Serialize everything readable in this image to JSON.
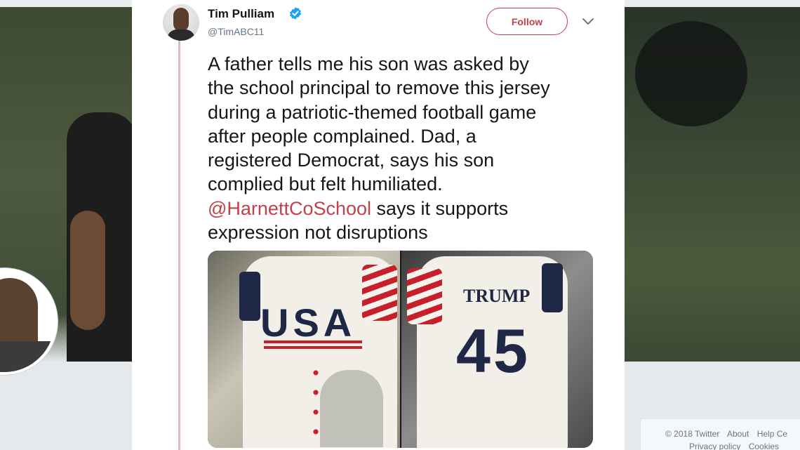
{
  "tweet": {
    "author_name": "Tim Pulliam",
    "author_handle": "@TimABC11",
    "follow_label": "Follow",
    "text_lines": [
      "A father tells me his son was asked by",
      "the school principal to remove this jersey",
      "during a patriotic-themed football game",
      "after people complained. Dad, a",
      "registered Democrat, says his son",
      "complied but felt humiliated."
    ],
    "mention": "@HarnettCoSchool",
    "text_after_mention": " says it supports",
    "last_line": "expression not disruptions",
    "media": {
      "left_jersey_text": "USA",
      "right_jersey_name": "TRUMP",
      "right_jersey_number": "45"
    }
  },
  "footer": {
    "copyright": "© 2018 Twitter",
    "about": "About",
    "help": "Help Ce",
    "privacy": "Privacy policy",
    "cookies": "Cookies"
  },
  "colors": {
    "accent": "#c0424a",
    "verified": "#1da1f2",
    "text": "#14171a",
    "secondary_text": "#657786"
  },
  "icons": {
    "verified": "verified-badge-icon",
    "more": "chevron-down-icon"
  }
}
